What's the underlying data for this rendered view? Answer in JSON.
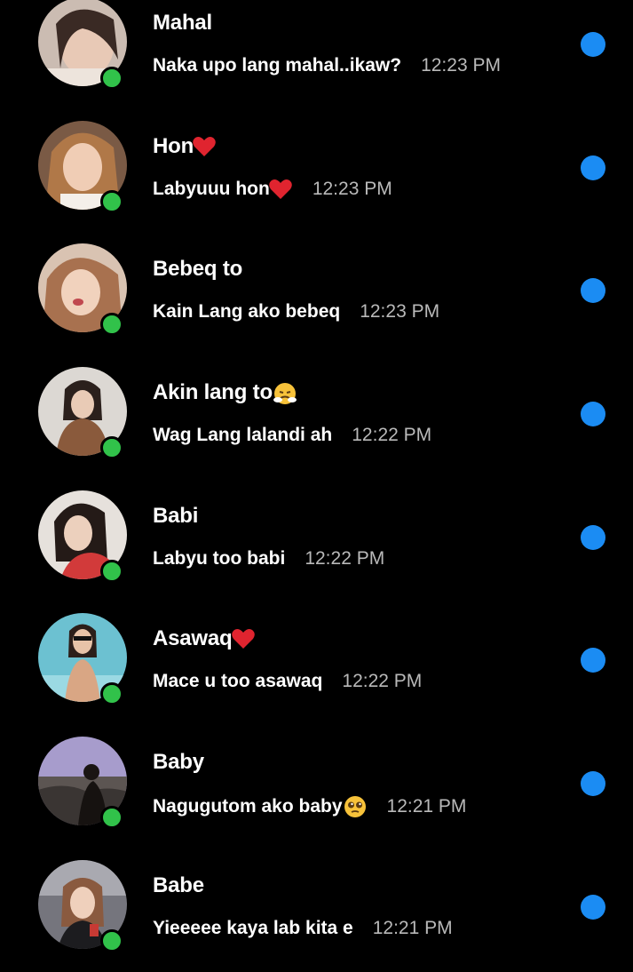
{
  "colors": {
    "background": "#000000",
    "online": "#31c24a",
    "unread": "#1b8cf3",
    "time": "#b9b9b9",
    "heart": "#e0242f"
  },
  "chats": [
    {
      "name": "Mahal",
      "name_emoji": "",
      "message": "Naka upo lang mahal..ikaw?",
      "message_emoji": "",
      "time": "12:23 PM",
      "online": true,
      "unread": true,
      "avatar_bg": "#c9b7ad"
    },
    {
      "name": "Hon",
      "name_emoji": "red-heart-icon",
      "message": "Labyuuu hon",
      "message_emoji": "red-heart-icon",
      "time": "12:23 PM",
      "online": true,
      "unread": true,
      "avatar_bg": "#8a6a52"
    },
    {
      "name": "Bebeq to",
      "name_emoji": "",
      "message": "Kain Lang ako bebeq",
      "message_emoji": "",
      "time": "12:23 PM",
      "online": true,
      "unread": true,
      "avatar_bg": "#b07a5e"
    },
    {
      "name": "Akin lang to",
      "name_emoji": "steaming-face-icon",
      "message": "Wag Lang lalandi ah",
      "message_emoji": "",
      "time": "12:22 PM",
      "online": true,
      "unread": true,
      "avatar_bg": "#d9d4cf"
    },
    {
      "name": "Babi",
      "name_emoji": "",
      "message": "Labyu too babi",
      "message_emoji": "",
      "time": "12:22 PM",
      "online": true,
      "unread": true,
      "avatar_bg": "#e3ddd6"
    },
    {
      "name": "Asawaq",
      "name_emoji": "red-heart-icon",
      "message": "Mace u too asawaq",
      "message_emoji": "",
      "time": "12:22 PM",
      "online": true,
      "unread": true,
      "avatar_bg": "#5fb8c8"
    },
    {
      "name": "Baby",
      "name_emoji": "",
      "message": "Nagugutom ako baby",
      "message_emoji": "pleading-face-icon",
      "time": "12:21 PM",
      "online": true,
      "unread": true,
      "avatar_bg": "#8f86b3"
    },
    {
      "name": "Babe",
      "name_emoji": "",
      "message": "Yieeeee kaya lab kita e",
      "message_emoji": "",
      "time": "12:21 PM",
      "online": true,
      "unread": true,
      "avatar_bg": "#6b6b72"
    }
  ]
}
